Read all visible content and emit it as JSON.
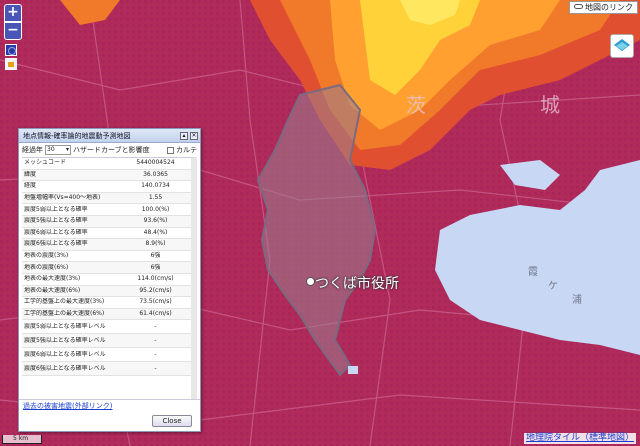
{
  "map": {
    "place_label": "つくば市役所",
    "kanji_labels": [
      "茨",
      "城",
      "霞",
      "ケ",
      "浦"
    ],
    "colors": {
      "background": "#b02a5a",
      "high_hazard": "#f07a2a",
      "very_high_hazard": "#ffd23a",
      "lake": "#c8d8f4",
      "city_boundary": "#8f7f95"
    }
  },
  "controls": {
    "zoom_in": "+",
    "zoom_out": "−",
    "map_link": "地図のリンク",
    "scale": "5 km"
  },
  "attribution": "地理院タイル（標準地図）",
  "panel": {
    "title": "地点情報-確率論的地震動予測地図",
    "period_label": "経過年",
    "period_value": "30",
    "hazard_curve": "ハザードカーブと影響度",
    "karte": "カルテ",
    "rows": [
      {
        "label": "メッシュコード",
        "value": "5440004524"
      },
      {
        "label": "緯度",
        "value": "36.0365"
      },
      {
        "label": "経度",
        "value": "140.0734"
      },
      {
        "label": "地盤増幅率(Vs=400～地表)",
        "value": "1.55"
      },
      {
        "label": "震度5弱以上となる確率",
        "value": "100.0(%)"
      },
      {
        "label": "震度5強以上となる確率",
        "value": "93.6(%)"
      },
      {
        "label": "震度6弱以上となる確率",
        "value": "48.4(%)"
      },
      {
        "label": "震度6強以上となる確率",
        "value": "8.9(%)"
      },
      {
        "label": "地表の震度(3%)",
        "value": "6強"
      },
      {
        "label": "地表の震度(6%)",
        "value": "6強"
      },
      {
        "label": "地表の最大速度(3%)",
        "value": "114.0(cm/s)"
      },
      {
        "label": "地表の最大速度(6%)",
        "value": "95.2(cm/s)"
      },
      {
        "label": "工学的基盤上の最大速度(3%)",
        "value": "73.5(cm/s)"
      },
      {
        "label": "工学的基盤上の最大速度(6%)",
        "value": "61.4(cm/s)"
      },
      {
        "label": "震度5弱以上となる確率レベル",
        "value": "-"
      },
      {
        "label": "震度5強以上となる確率レベル",
        "value": "-"
      },
      {
        "label": "震度6弱以上となる確率レベル",
        "value": "-"
      },
      {
        "label": "震度6強以上となる確率レベル",
        "value": "-"
      }
    ],
    "history_link": "過去の被害地震(外部リンク)",
    "close_label": "Close"
  }
}
